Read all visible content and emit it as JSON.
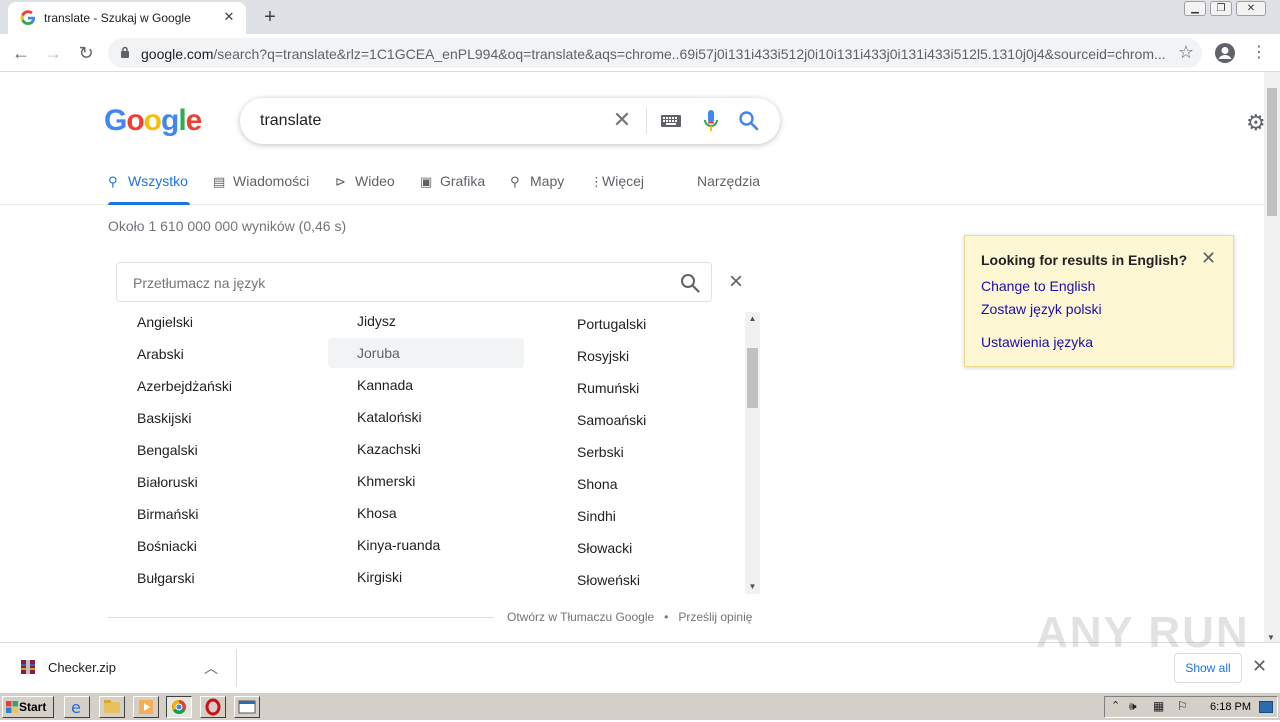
{
  "browser": {
    "tab_title": "translate - Szukaj w Google",
    "url_host": "google.com",
    "url_rest": "/search?q=translate&rlz=1C1GCEA_enPL994&oq=translate&aqs=chrome..69i57j0i131i433i512j0i10i131i433j0i131i433i512l5.1310j0j4&sourceid=chrom..."
  },
  "search": {
    "logo": "Google",
    "query": "translate"
  },
  "tabs": [
    {
      "label": "Wszystko",
      "icon": "search-icon"
    },
    {
      "label": "Wiadomości",
      "icon": "news-icon"
    },
    {
      "label": "Wideo",
      "icon": "video-icon"
    },
    {
      "label": "Grafika",
      "icon": "image-icon"
    },
    {
      "label": "Mapy",
      "icon": "map-pin-icon"
    },
    {
      "label": "Więcej",
      "icon": "more-vert-icon"
    },
    {
      "label": "Narzędzia",
      "icon": ""
    }
  ],
  "results_stats": "Około 1 610 000 000 wyników (0,46 s)",
  "translator": {
    "search_placeholder": "Przetłumacz na język",
    "columns": [
      [
        "Angielski",
        "Arabski",
        "Azerbejdżański",
        "Baskijski",
        "Bengalski",
        "Białoruski",
        "Birmański",
        "Bośniacki",
        "Bułgarski"
      ],
      [
        "Jidysz",
        "Joruba",
        "Kannada",
        "Kataloński",
        "Kazachski",
        "Khmerski",
        "Khosa",
        "Kinya-ruanda",
        "Kirgiski"
      ],
      [
        "Portugalski",
        "Rosyjski",
        "Rumuński",
        "Samoański",
        "Serbski",
        "Shona",
        "Sindhi",
        "Słowacki",
        "Słoweński"
      ]
    ],
    "highlighted": "Joruba",
    "footer_open": "Otwórz w Tłumaczu Google",
    "footer_sep": "•",
    "footer_feedback": "Prześlij opinię"
  },
  "english_panel": {
    "heading": "Looking for results in English?",
    "change": "Change to English",
    "keep": "Zostaw język polski",
    "settings": "Ustawienia języka"
  },
  "download_bar": {
    "file": "Checker.zip",
    "show_all": "Show all"
  },
  "watermark": "ANY RUN",
  "taskbar": {
    "start": "Start",
    "clock": "6:18 PM"
  }
}
